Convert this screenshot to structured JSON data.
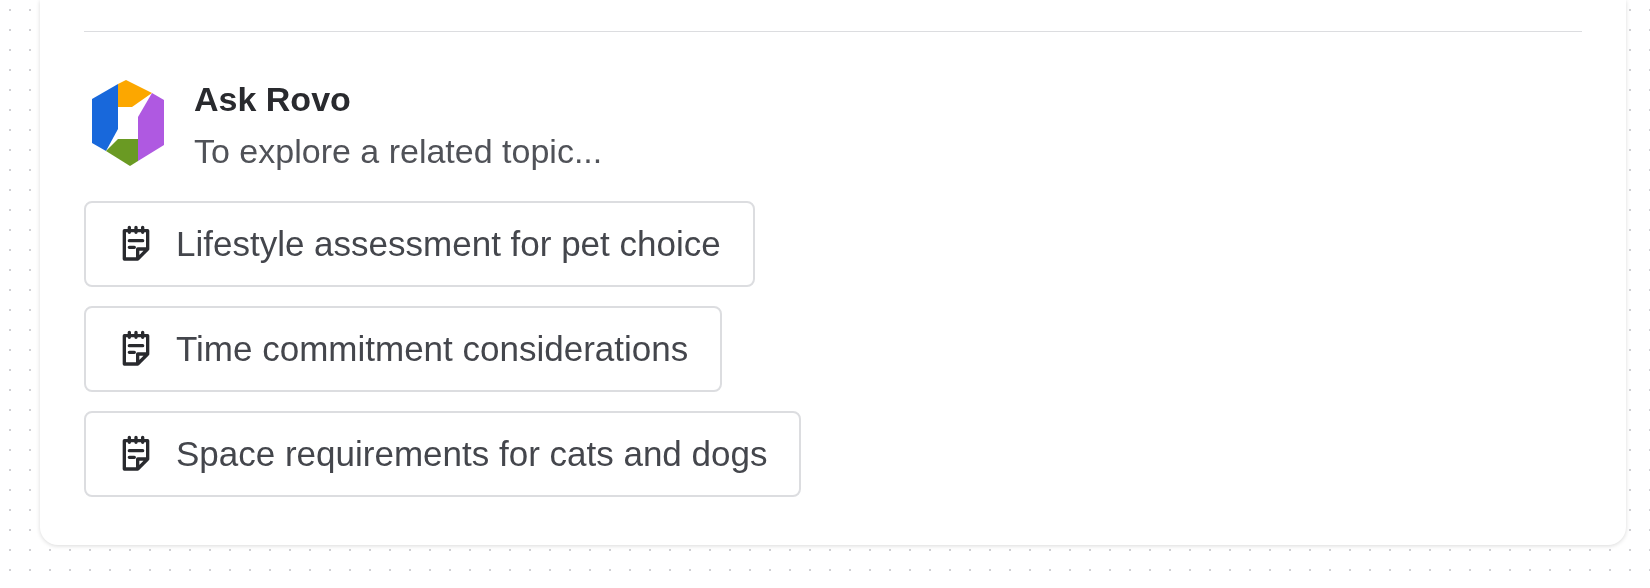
{
  "panel": {
    "title": "Ask Rovo",
    "subtitle": "To explore a related topic...",
    "suggestions": [
      {
        "label": "Lifestyle assessment for pet choice"
      },
      {
        "label": "Time commitment considerations"
      },
      {
        "label": "Space requirements for cats and dogs"
      }
    ]
  }
}
